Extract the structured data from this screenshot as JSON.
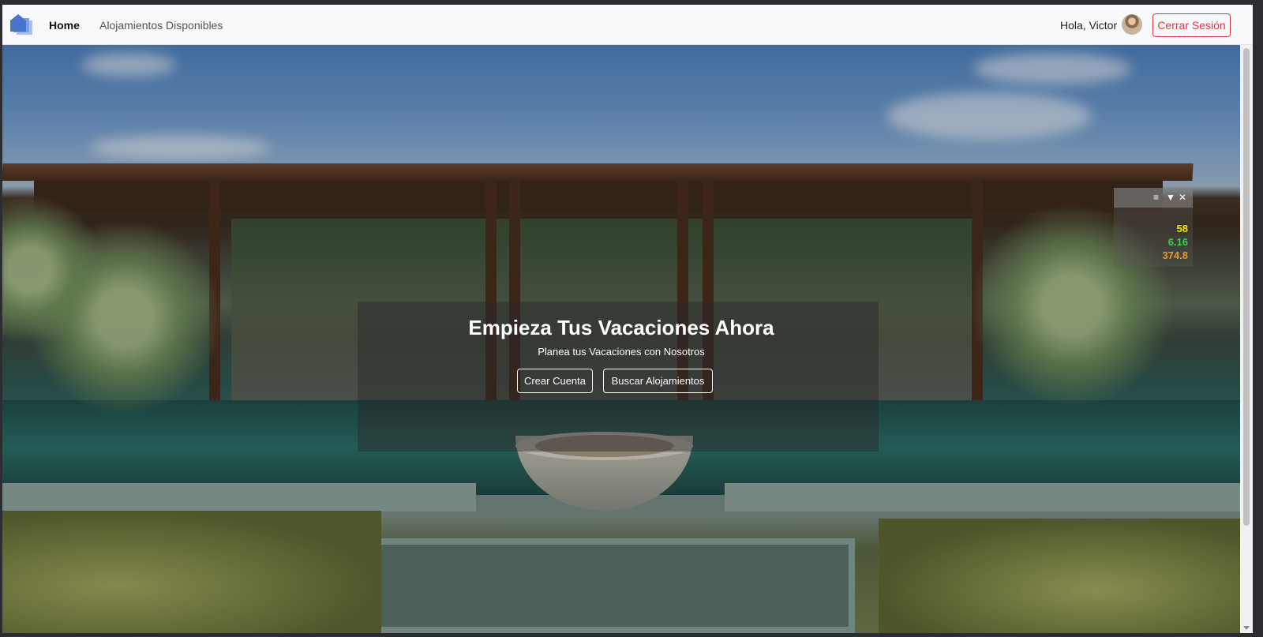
{
  "navbar": {
    "home_label": "Home",
    "alojamientos_label": "Alojamientos Disponibles",
    "greeting": "Hola, Victor",
    "logout_label": "Cerrar Sesión"
  },
  "hero": {
    "title": "Empieza Tus Vacaciones Ahora",
    "subtitle": "Planea tus Vacaciones con Nosotros",
    "btn_create": "Crear Cuenta",
    "btn_search": "Buscar Alojamientos"
  },
  "widget": {
    "menu_icon": "≡",
    "filter_icon": "▼",
    "close_icon": "✕",
    "value1": "58",
    "value2": "6.16",
    "value3": "374.8",
    "colors": {
      "value1": "#f2e600",
      "value2": "#39d44a",
      "value3": "#f09a1a"
    }
  },
  "colors": {
    "danger": "#dc3545",
    "logo": "#4a74c9"
  }
}
